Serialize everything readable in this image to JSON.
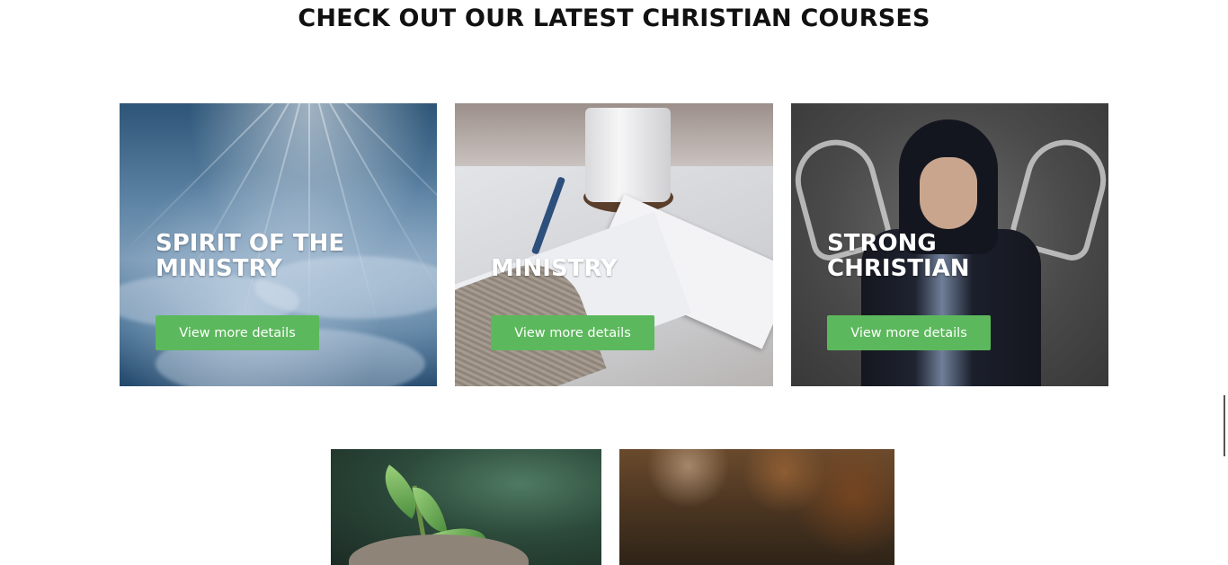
{
  "section": {
    "title": "CHECK OUT OUR LATEST CHRISTIAN COURSES"
  },
  "courses": [
    {
      "title_line1": "SPIRIT OF THE",
      "title_line2": "MINISTRY",
      "button_label": "View more details",
      "image": "sky-clouds-light-rays"
    },
    {
      "title_line1": "",
      "title_line2": "MINISTRY",
      "button_label": "View more details",
      "image": "hand-writing-with-coffee-mug"
    },
    {
      "title_line1": "STRONG",
      "title_line2": "CHRISTIAN",
      "button_label": "View more details",
      "image": "hooded-man-chalk-muscles"
    },
    {
      "image": "seedling-in-hand"
    },
    {
      "image": "autumn-blurred-forest"
    }
  ],
  "colors": {
    "button_green": "#5cb85c",
    "title_text": "#111111",
    "card_text": "#ffffff"
  }
}
